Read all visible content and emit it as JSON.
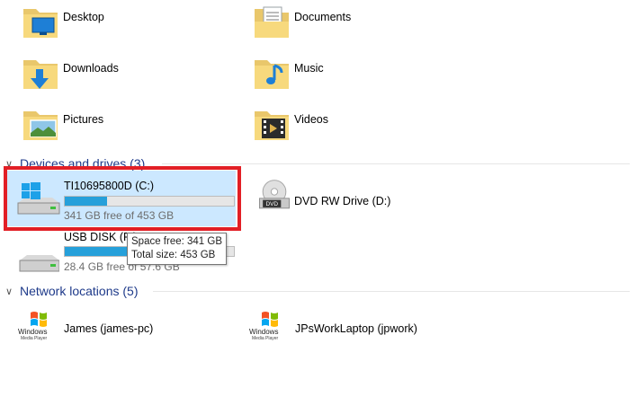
{
  "folders": [
    {
      "label": "Desktop",
      "icon": "desktop-folder-icon"
    },
    {
      "label": "Documents",
      "icon": "documents-folder-icon"
    },
    {
      "label": "Downloads",
      "icon": "downloads-folder-icon"
    },
    {
      "label": "Music",
      "icon": "music-folder-icon"
    },
    {
      "label": "Pictures",
      "icon": "pictures-folder-icon"
    },
    {
      "label": "Videos",
      "icon": "videos-folder-icon"
    }
  ],
  "devices": {
    "header": "Devices and drives (3)",
    "drives": [
      {
        "name": "TI10695800D (C:)",
        "free_text": "341 GB free of 453 GB",
        "used_fraction": 0.25,
        "icon": "windows-drive-icon",
        "selected": true
      },
      {
        "name": "DVD RW Drive (D:)",
        "icon": "dvd-drive-icon"
      },
      {
        "name": "USB DISK (F:)",
        "free_text": "28.4 GB free of 57.6 GB",
        "used_fraction": 0.51,
        "icon": "usb-drive-icon"
      }
    ]
  },
  "tooltip": {
    "line1": "Space free: 341 GB",
    "line2": "Total size: 453 GB"
  },
  "network": {
    "header": "Network locations (5)",
    "items": [
      {
        "label": "James (james-pc)",
        "icon": "windows-media-player-icon",
        "icon_text1": "Windows",
        "icon_text2": "Media Player"
      },
      {
        "label": "JPsWorkLaptop (jpwork)",
        "icon": "windows-media-player-icon",
        "icon_text1": "Windows",
        "icon_text2": "Media Player"
      }
    ]
  },
  "colors": {
    "accent": "#26a0da",
    "selection": "#cce8ff",
    "highlight": "#e21f26",
    "header": "#1e3a8a"
  }
}
